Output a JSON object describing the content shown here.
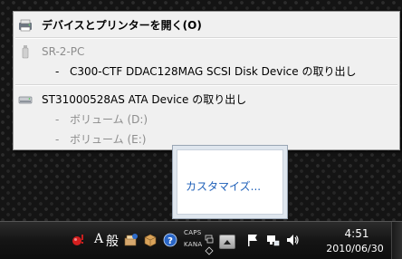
{
  "menu": {
    "open_devices_label": "デバイスとプリンターを開く(O)",
    "computer_name": "SR-2-PC",
    "c300_dash": "-",
    "c300_label": "C300-CTF DDAC128MAG SCSI Disk Device の取り出し",
    "st_label": "ST31000528AS ATA Device の取り出し",
    "vol_d_dash": "-",
    "vol_d_label": "ボリューム (D:)",
    "vol_e_dash": "-",
    "vol_e_label": "ボリューム (E:)"
  },
  "tray_panel": {
    "customize_label": "カスタマイズ..."
  },
  "taskbar": {
    "ime_mode": "A",
    "ime_kanji": "般",
    "caps": "CAPS",
    "kana": "KANA",
    "time": "4:51",
    "date": "2010/06/30"
  },
  "colors": {
    "menu_bg": "#f0f0f0",
    "disabled_text": "#8d8d8d",
    "link_blue": "#1e5fb8"
  }
}
